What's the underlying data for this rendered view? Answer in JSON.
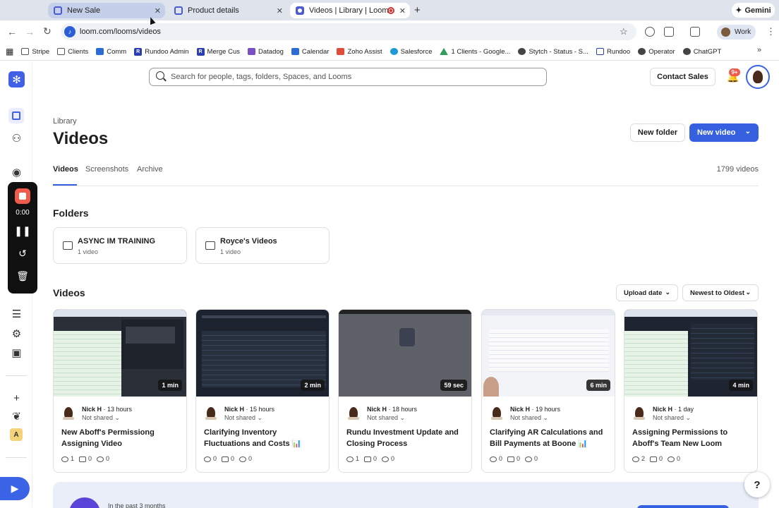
{
  "browser": {
    "tabs": [
      {
        "label": "New Sale"
      },
      {
        "label": "Product details"
      },
      {
        "label": "Videos | Library | Loom"
      }
    ],
    "gemini_label": "Gemini",
    "url": "loom.com/looms/videos",
    "profile_label": "Work",
    "bookmarks": [
      "Stripe",
      "Clients",
      "Comm",
      "Rundoo Admin",
      "Merge Cus",
      "Datadog",
      "Calendar",
      "Zoho Assist",
      "Salesforce",
      "1 Clients - Google...",
      "Stytch - Status - S...",
      "Rundoo",
      "Operator",
      "ChatGPT"
    ]
  },
  "recorder": {
    "time": "0:00"
  },
  "header": {
    "search_placeholder": "Search for people, tags, folders, Spaces, and Looms",
    "contact_sales": "Contact Sales",
    "notifications_badge": "9+"
  },
  "library": {
    "breadcrumb": "Library",
    "title": "Videos",
    "new_folder": "New folder",
    "new_video": "New video",
    "tabs": [
      "Videos",
      "Screenshots",
      "Archive"
    ],
    "video_count": "1799 videos",
    "folders_heading": "Folders",
    "folders": [
      {
        "name": "ASYNC IM TRAINING",
        "count": "1 video"
      },
      {
        "name": "Royce's Videos",
        "count": "1 video"
      }
    ],
    "videos_heading": "Videos",
    "sort_field": "Upload date",
    "sort_order": "Newest to Oldest",
    "videos": [
      {
        "duration": "1 min",
        "author": "Nick H",
        "time": "13 hours",
        "sharing": "Not shared",
        "title": "New Aboff's Permissiong Assigning Video",
        "views": "1",
        "comments": "0",
        "reactions": "0"
      },
      {
        "duration": "2 min",
        "author": "Nick H",
        "time": "15 hours",
        "sharing": "Not shared",
        "title": "Clarifying Inventory Fluctuations and Costs 📊",
        "views": "0",
        "comments": "0",
        "reactions": "0"
      },
      {
        "duration": "59 sec",
        "author": "Nick H",
        "time": "18 hours",
        "sharing": "Not shared",
        "title": "Rundu Investment Update and Closing Process",
        "views": "1",
        "comments": "0",
        "reactions": "0"
      },
      {
        "duration": "6 min",
        "author": "Nick H",
        "time": "19 hours",
        "sharing": "Not shared",
        "title": "Clarifying AR Calculations and Bill Payments at Boone 📊",
        "views": "0",
        "comments": "0",
        "reactions": "0"
      },
      {
        "duration": "4 min",
        "author": "Nick H",
        "time": "1 day",
        "sharing": "Not shared",
        "title": "Assigning Permissions to Aboff's Team New Loom",
        "views": "2",
        "comments": "0",
        "reactions": "0"
      }
    ]
  },
  "banner": {
    "text": "In the past 3 months"
  },
  "help_label": "?",
  "colors": {
    "accent": "#3561e0",
    "record": "#ef5a4a"
  }
}
